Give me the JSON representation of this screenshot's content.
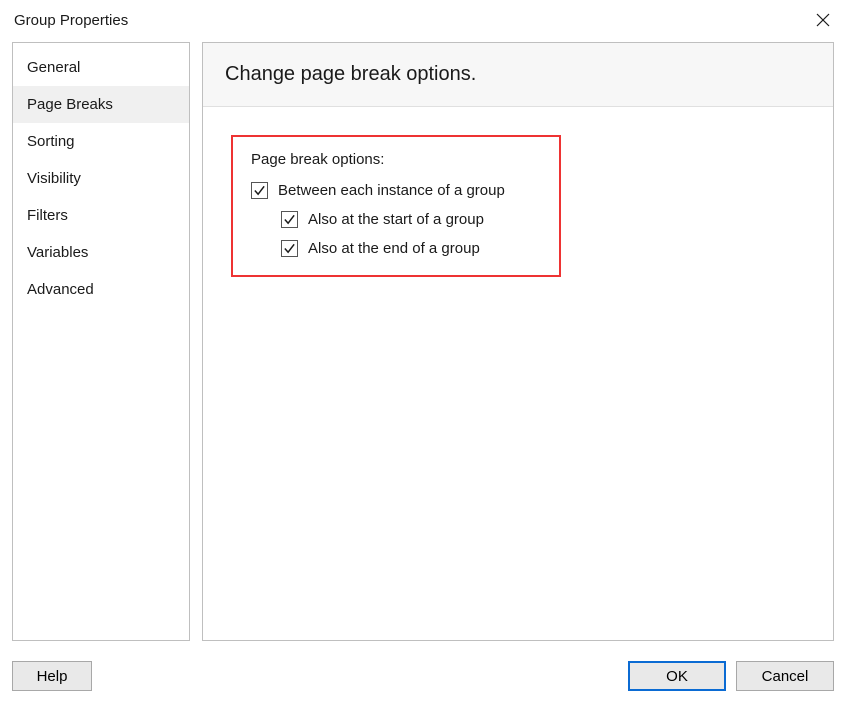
{
  "window": {
    "title": "Group Properties"
  },
  "sidebar": {
    "items": [
      {
        "label": "General"
      },
      {
        "label": "Page Breaks"
      },
      {
        "label": "Sorting"
      },
      {
        "label": "Visibility"
      },
      {
        "label": "Filters"
      },
      {
        "label": "Variables"
      },
      {
        "label": "Advanced"
      }
    ],
    "selectedIndex": 1
  },
  "panel": {
    "heading": "Change page break options.",
    "groupLabel": "Page break options:",
    "options": [
      {
        "label": "Between each instance of a group",
        "checked": true
      },
      {
        "label": "Also at the start of a group",
        "checked": true
      },
      {
        "label": "Also at the end of a group",
        "checked": true
      }
    ]
  },
  "buttons": {
    "help": "Help",
    "ok": "OK",
    "cancel": "Cancel"
  }
}
